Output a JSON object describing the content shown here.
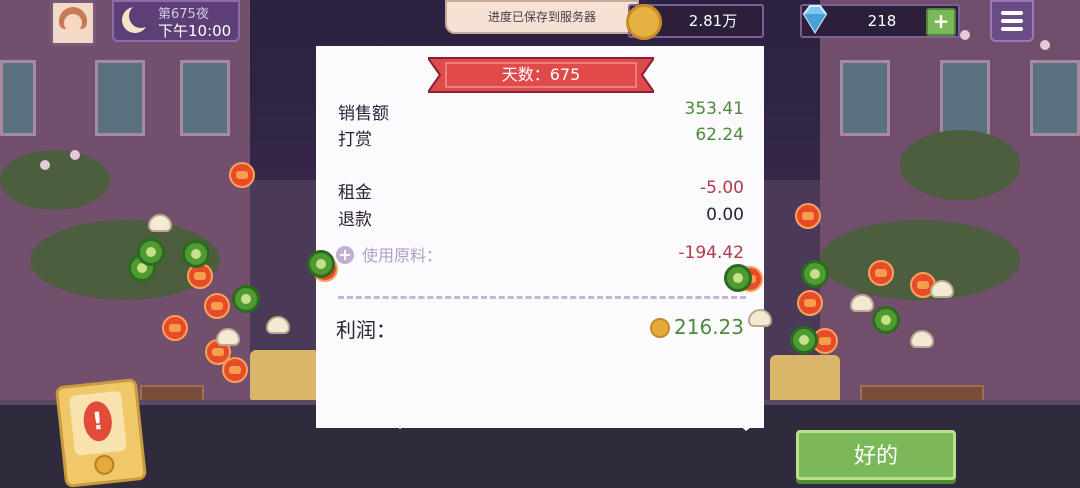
{
  "hud": {
    "day_label": "第675夜",
    "time_label": "下午10:00",
    "save_toast": "进度已保存到服务器",
    "coins": "2.81万",
    "gems": "218",
    "gem_plus": "+"
  },
  "receipt": {
    "banner": "天数：675",
    "rows": [
      {
        "label": "销售额",
        "value": "353.41"
      },
      {
        "label": "打赏",
        "value": "62.24"
      },
      {
        "label": "租金",
        "value": "-5.00"
      },
      {
        "label": "退款",
        "value": "0.00"
      }
    ],
    "ingredients_label": "使用原料：",
    "ingredients_value": "-194.42",
    "profit_label": "利润：",
    "profit_value": "216.23"
  },
  "buttons": {
    "ok": "好的",
    "alert": "!"
  },
  "colors": {
    "positive": "#4e8a3c",
    "negative": "#b23a4a",
    "banner": "#e04a4a",
    "ok_button": "#7bb85a"
  },
  "icons": [
    "avatar",
    "moon-icon",
    "coin-icon",
    "diamond-icon",
    "plus-icon",
    "menu-icon",
    "plus-circle-icon",
    "coin-icon",
    "alert-card-icon"
  ]
}
